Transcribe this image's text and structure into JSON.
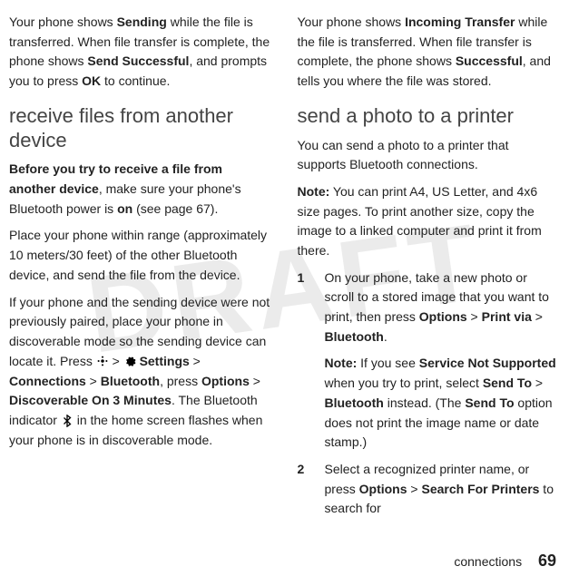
{
  "watermark": "DRAFT",
  "left": {
    "intro_parts": {
      "t1": "Your phone shows ",
      "b1": "Sending",
      "t2": " while the file is transferred. When file transfer is complete, the phone shows ",
      "b2": "Send Successful",
      "t3": ", and prompts you to press ",
      "b3": "OK",
      "t4": " to continue."
    },
    "heading": "receive files from another device",
    "para1": {
      "b1": "Before you try to receive a file from another device",
      "t1": ", make sure your phone's Bluetooth power is ",
      "b2": "on",
      "t2": " (see page 67)."
    },
    "para2": "Place your phone within range (approximately 10 meters/30 feet) of the other Bluetooth device, and send the file from the device.",
    "para3": {
      "t1": "If your phone and the sending device were not previously paired, place your phone in discoverable mode so the sending device can locate it. Press ",
      "gt1": " > ",
      "b_settings": "Settings",
      "gt2": " > ",
      "b_conn": "Connections",
      "gt3": " > ",
      "b_bt": "Bluetooth",
      "t2": ", press ",
      "b_opt": "Options",
      "gt4": " > ",
      "b_disc": "Discoverable On 3 Minutes",
      "t3": ". The Bluetooth indicator ",
      "t4": " in the home screen flashes when your phone is in discoverable mode."
    }
  },
  "right": {
    "intro_parts": {
      "t1": "Your phone shows ",
      "b1": "Incoming Transfer",
      "t2": " while the file is transferred. When file transfer is complete, the phone shows ",
      "b2": "Successful",
      "t3": ", and tells you where the file was stored."
    },
    "heading": "send a photo to a printer",
    "para1": "You can send a photo to a printer that supports Bluetooth connections.",
    "note1": {
      "label": "Note:",
      "text": " You can print A4, US Letter, and 4x6 size pages. To print another size, copy the image to a linked computer and print it from there."
    },
    "step1": {
      "num": "1",
      "t1": "On your phone, take a new photo or scroll to a stored image that you want to print, then press ",
      "b_opt": "Options",
      "gt1": " > ",
      "b_print": "Print via",
      "gt2": " > ",
      "b_bt": "Bluetooth",
      "t2": "."
    },
    "step1note": {
      "label": "Note:",
      "t1": " If you see ",
      "b_sns": "Service Not Supported",
      "t2": " when you try to print, select ",
      "b_sendto": "Send To",
      "gt1": " > ",
      "b_bt": "Bluetooth",
      "t3": " instead. (The ",
      "b_sendto2": "Send To",
      "t4": " option does not print the image name or date stamp.)"
    },
    "step2": {
      "num": "2",
      "t1": "Select a recognized printer name, or press ",
      "b_opt": "Options",
      "gt1": " > ",
      "b_search": "Search For Printers",
      "t2": " to search for"
    }
  },
  "footer": {
    "section": "connections",
    "page": "69"
  },
  "icons": {
    "key": "s-key-icon",
    "gear": "gear-icon",
    "bt": "bluetooth-icon"
  }
}
